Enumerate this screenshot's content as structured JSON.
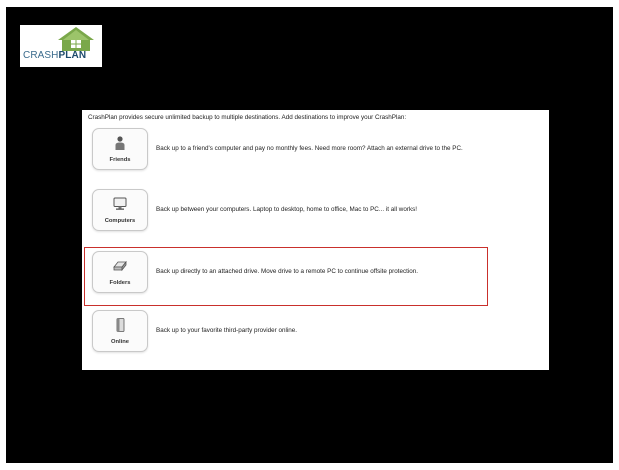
{
  "logo": {
    "text_left": "CRASH",
    "text_right": "PLAN"
  },
  "intro_text": "CrashPlan provides secure unlimited backup to multiple destinations. Add destinations to improve your CrashPlan:",
  "destinations": [
    {
      "label": "Friends",
      "icon": "person-icon",
      "description": "Back up to a friend's computer and pay no monthly fees. Need more room? Attach an external drive to the PC."
    },
    {
      "label": "Computers",
      "icon": "monitor-icon",
      "description": "Back up between your computers. Laptop to desktop, home to office, Mac to PC... it all works!"
    },
    {
      "label": "Folders",
      "icon": "drive-icon",
      "description": "Back up directly to an attached drive. Move drive to a remote PC to continue offsite protection."
    },
    {
      "label": "Online",
      "icon": "server-icon",
      "description": "Back up to your favorite third-party provider online."
    }
  ],
  "selected_index": 2,
  "colors": {
    "background": "#000000",
    "highlight": "#c9302c",
    "logo_green": "#6a9a3a",
    "logo_blue": "#1d4a6b"
  }
}
